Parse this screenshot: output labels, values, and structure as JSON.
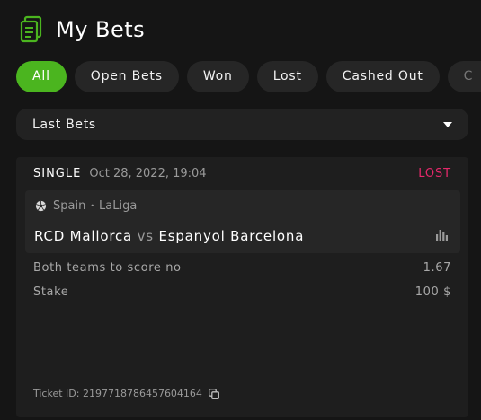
{
  "header": {
    "title": "My Bets",
    "icon": "receipt-icon"
  },
  "tabs": [
    {
      "label": "All",
      "active": true
    },
    {
      "label": "Open Bets"
    },
    {
      "label": "Won"
    },
    {
      "label": "Lost"
    },
    {
      "label": "Cashed Out"
    },
    {
      "label": "C"
    }
  ],
  "filter": {
    "selected": "Last Bets"
  },
  "bet": {
    "type": "SINGLE",
    "date": "Oct 28, 2022, 19:04",
    "status": "LOST",
    "country": "Spain",
    "league": "LaLiga",
    "home": "RCD Mallorca",
    "vs": "vs",
    "away": "Espanyol Barcelona",
    "selection": "Both teams to score no",
    "odds": "1.67",
    "stake_label": "Stake",
    "stake": "100 $",
    "ticket": "Ticket ID: 2197718786457604164"
  },
  "colors": {
    "accent": "#4bb51f",
    "lost": "#e6286b",
    "background": "#151515"
  }
}
